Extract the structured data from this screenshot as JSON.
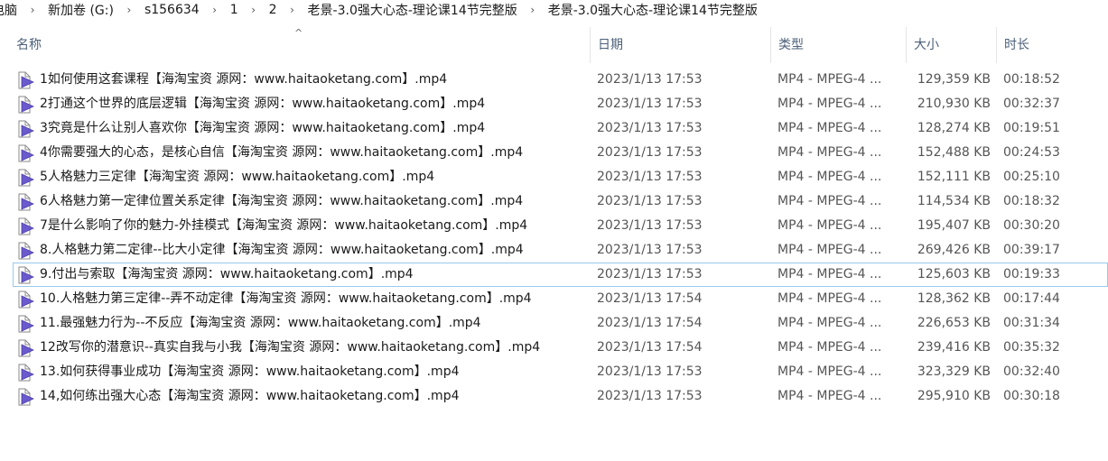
{
  "breadcrumb": [
    "电脑",
    "新加卷 (G:)",
    "s156634",
    "1",
    "2",
    "老景-3.0强大心态-理论课14节完整版",
    "老景-3.0强大心态-理论课14节完整版"
  ],
  "breadcrumb_separator": "›",
  "columns": {
    "name": "名称",
    "date": "日期",
    "type": "类型",
    "size": "大小",
    "length": "时长"
  },
  "sort_indicator": "^",
  "files": [
    {
      "name": "1如何使用这套课程【海淘宝资 源网：www.haitaoketang.com】.mp4",
      "date": "2023/1/13 17:53",
      "type": "MP4 - MPEG-4 ...",
      "size": "129,359 KB",
      "length": "00:18:52"
    },
    {
      "name": "2打通这个世界的底层逻辑【海淘宝资 源网：www.haitaoketang.com】.mp4",
      "date": "2023/1/13 17:53",
      "type": "MP4 - MPEG-4 ...",
      "size": "210,930 KB",
      "length": "00:32:37"
    },
    {
      "name": "3究竟是什么让别人喜欢你【海淘宝资 源网：www.haitaoketang.com】.mp4",
      "date": "2023/1/13 17:53",
      "type": "MP4 - MPEG-4 ...",
      "size": "128,274 KB",
      "length": "00:19:51"
    },
    {
      "name": "4你需要强大的心态，是核心自信【海淘宝资 源网：www.haitaoketang.com】.mp4",
      "date": "2023/1/13 17:53",
      "type": "MP4 - MPEG-4 ...",
      "size": "152,488 KB",
      "length": "00:24:53"
    },
    {
      "name": "5人格魅力三定律【海淘宝资 源网：www.haitaoketang.com】.mp4",
      "date": "2023/1/13 17:53",
      "type": "MP4 - MPEG-4 ...",
      "size": "152,111 KB",
      "length": "00:25:10"
    },
    {
      "name": "6人格魅力第一定律位置关系定律【海淘宝资 源网：www.haitaoketang.com】.mp4",
      "date": "2023/1/13 17:53",
      "type": "MP4 - MPEG-4 ...",
      "size": "114,534 KB",
      "length": "00:18:32"
    },
    {
      "name": "7是什么影响了你的魅力-外挂模式【海淘宝资 源网：www.haitaoketang.com】.mp4",
      "date": "2023/1/13 17:53",
      "type": "MP4 - MPEG-4 ...",
      "size": "195,407 KB",
      "length": "00:30:20"
    },
    {
      "name": "8.人格魅力第二定律--比大小定律【海淘宝资 源网：www.haitaoketang.com】.mp4",
      "date": "2023/1/13 17:53",
      "type": "MP4 - MPEG-4 ...",
      "size": "269,426 KB",
      "length": "00:39:17"
    },
    {
      "name": "9.付出与索取【海淘宝资 源网：www.haitaoketang.com】.mp4",
      "date": "2023/1/13 17:53",
      "type": "MP4 - MPEG-4 ...",
      "size": "125,603 KB",
      "length": "00:19:33"
    },
    {
      "name": "10.人格魅力第三定律--弄不动定律【海淘宝资 源网：www.haitaoketang.com】.mp4",
      "date": "2023/1/13 17:54",
      "type": "MP4 - MPEG-4 ...",
      "size": "128,362 KB",
      "length": "00:17:44"
    },
    {
      "name": "11.最强魅力行为--不反应【海淘宝资 源网：www.haitaoketang.com】.mp4",
      "date": "2023/1/13 17:54",
      "type": "MP4 - MPEG-4 ...",
      "size": "226,653 KB",
      "length": "00:31:34"
    },
    {
      "name": "12改写你的潜意识--真实自我与小我【海淘宝资 源网：www.haitaoketang.com】.mp4",
      "date": "2023/1/13 17:54",
      "type": "MP4 - MPEG-4 ...",
      "size": "239,416 KB",
      "length": "00:35:32"
    },
    {
      "name": "13.如何获得事业成功【海淘宝资 源网：www.haitaoketang.com】.mp4",
      "date": "2023/1/13 17:53",
      "type": "MP4 - MPEG-4 ...",
      "size": "323,329 KB",
      "length": "00:32:40"
    },
    {
      "name": "14,如何练出强大心态【海淘宝资 源网：www.haitaoketang.com】.mp4",
      "date": "2023/1/13 17:53",
      "type": "MP4 - MPEG-4 ...",
      "size": "295,910 KB",
      "length": "00:30:18"
    }
  ],
  "focused_index": 8,
  "icon": "video-file-icon",
  "colors": {
    "header_text": "#4c607a",
    "icon_accent": "#6a5acd",
    "focus_border": "#99c8ec"
  }
}
